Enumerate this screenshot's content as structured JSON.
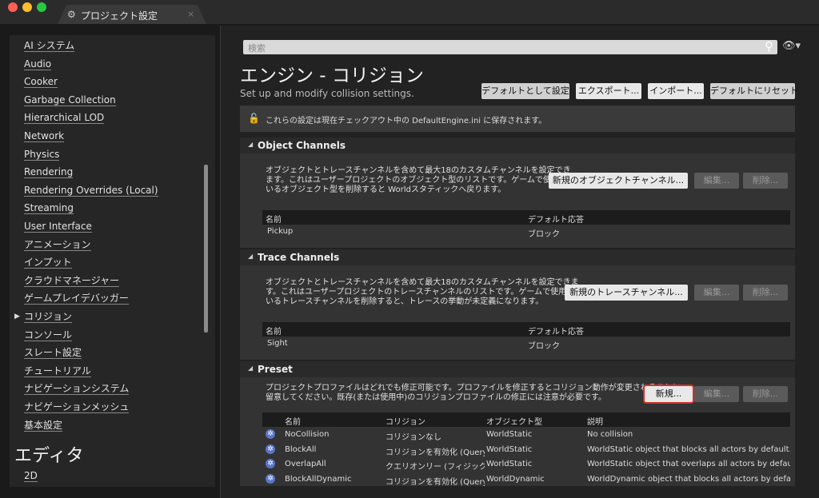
{
  "window": {
    "tab_title": "プロジェクト設定",
    "tab_close": "×",
    "traffic_lights": [
      "#ff5f57",
      "#febc2e",
      "#28c840"
    ]
  },
  "sidebar": {
    "items": [
      "AI システム",
      "Audio",
      "Cooker",
      "Garbage Collection",
      "Hierarchical LOD",
      "Network",
      "Physics",
      "Rendering",
      "Rendering Overrides (Local)",
      "Streaming",
      "User Interface",
      "アニメーション",
      "インプット",
      "クラウドマネージャー",
      "ゲームプレイデバッガー",
      "コリジョン",
      "コンソール",
      "スレート設定",
      "チュートリアル",
      "ナビゲーションシステム",
      "ナビゲーションメッシュ",
      "基本設定"
    ],
    "selected_index": 15,
    "section_title": "エディタ",
    "section_items": [
      "2D"
    ]
  },
  "search": {
    "placeholder": "検索"
  },
  "header": {
    "title": "エンジン - コリジョン",
    "subtitle": "Set up and modify collision settings.",
    "buttons": [
      "デフォルトとして設定",
      "エクスポート...",
      "インポート...",
      "デフォルトにリセット"
    ]
  },
  "notice": {
    "text": "これらの設定は現在チェックアウト中の DefaultEngine.ini に保存されます。"
  },
  "object_channels": {
    "title": "Object Channels",
    "description": [
      "オブジェクトとトレースチャンネルを含めて最大18のカスタムチャンネルを設定でき",
      "ます。これはユーザープロジェクトのオブジェクト型のリストです。ゲームで使用して",
      "いるオブジェクト型を削除すると Worldスタティックへ戻ります。"
    ],
    "new_button": "新規のオブジェクトチャンネル...",
    "edit_button": "編集...",
    "delete_button": "削除...",
    "columns": [
      "名前",
      "デフォルト応答"
    ],
    "rows": [
      [
        "Pickup",
        "ブロック"
      ]
    ]
  },
  "trace_channels": {
    "title": "Trace Channels",
    "description": [
      "オブジェクトとトレースチャンネルを含めて最大18のカスタムチャンネルを設定できま",
      "す。これはユーザープロジェクトのトレースチャンネルのリストです。ゲームで使用して",
      "いるトレースチャンネルを削除すると、トレースの挙動が未定義になります。"
    ],
    "new_button": "新規のトレースチャンネル...",
    "edit_button": "編集...",
    "delete_button": "削除...",
    "columns": [
      "名前",
      "デフォルト応答"
    ],
    "rows": [
      [
        "Sight",
        "ブロック"
      ]
    ]
  },
  "preset": {
    "title": "Preset",
    "description": [
      "プロジェクトプロファイルはどれでも修正可能です。プロファイルを修正するとコリジョン動作が変更されることに",
      "留意してください。既存(または使用中)のコリジョンプロファイルの修正には注意が必要です。"
    ],
    "new_button": "新規...",
    "edit_button": "編集...",
    "delete_button": "削除...",
    "columns": [
      "名前",
      "コリジョン",
      "オブジェクト型",
      "説明"
    ],
    "rows": [
      [
        "NoCollision",
        "コリジョンなし",
        "WorldStatic",
        "No collision"
      ],
      [
        "BlockAll",
        "コリジョンを有効化 (Query a",
        "WorldStatic",
        "WorldStatic object that blocks all actors by default. Al"
      ],
      [
        "OverlapAll",
        "クエリオンリー (フィジックスコ",
        "WorldStatic",
        "WorldStatic object that overlaps all actors by default."
      ],
      [
        "BlockAllDynamic",
        "コリジョンを有効化 (Query a",
        "WorldDynamic",
        "WorldDynamic object that blocks all actors by default"
      ]
    ]
  },
  "colors": {
    "accent_highlight": "#d0302a"
  }
}
